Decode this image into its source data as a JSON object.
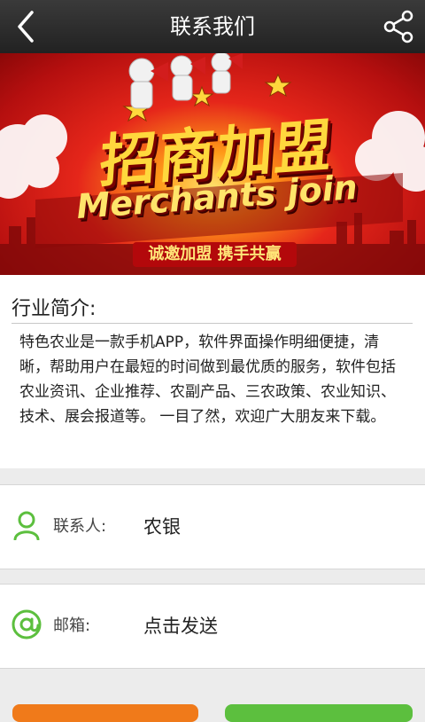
{
  "header": {
    "title": "联系我们",
    "back_icon": "chevron-left-icon",
    "share_icon": "share-icon"
  },
  "banner": {
    "headline": "招商加盟",
    "subheadline": "Merchants join",
    "tagline": "诚邀加盟   携手共赢"
  },
  "intro": {
    "heading": "行业简介:",
    "body": "特色农业是一款手机APP，软件界面操作明细便捷，清晰，帮助用户在最短的时间做到最优质的服务，软件包括农业资讯、企业推荐、农副产品、三农政策、农业知识、技术、展会报道等。 一目了然，欢迎广大朋友来下载。"
  },
  "contact": {
    "label": "联系人:",
    "value": "农银",
    "icon": "person-icon"
  },
  "email": {
    "label": "邮箱:",
    "value": "点击发送",
    "icon": "at-icon"
  },
  "colors": {
    "accent_green": "#5cbf3e",
    "accent_orange": "#f07a1a",
    "header_bg": "#2a2a2a"
  }
}
